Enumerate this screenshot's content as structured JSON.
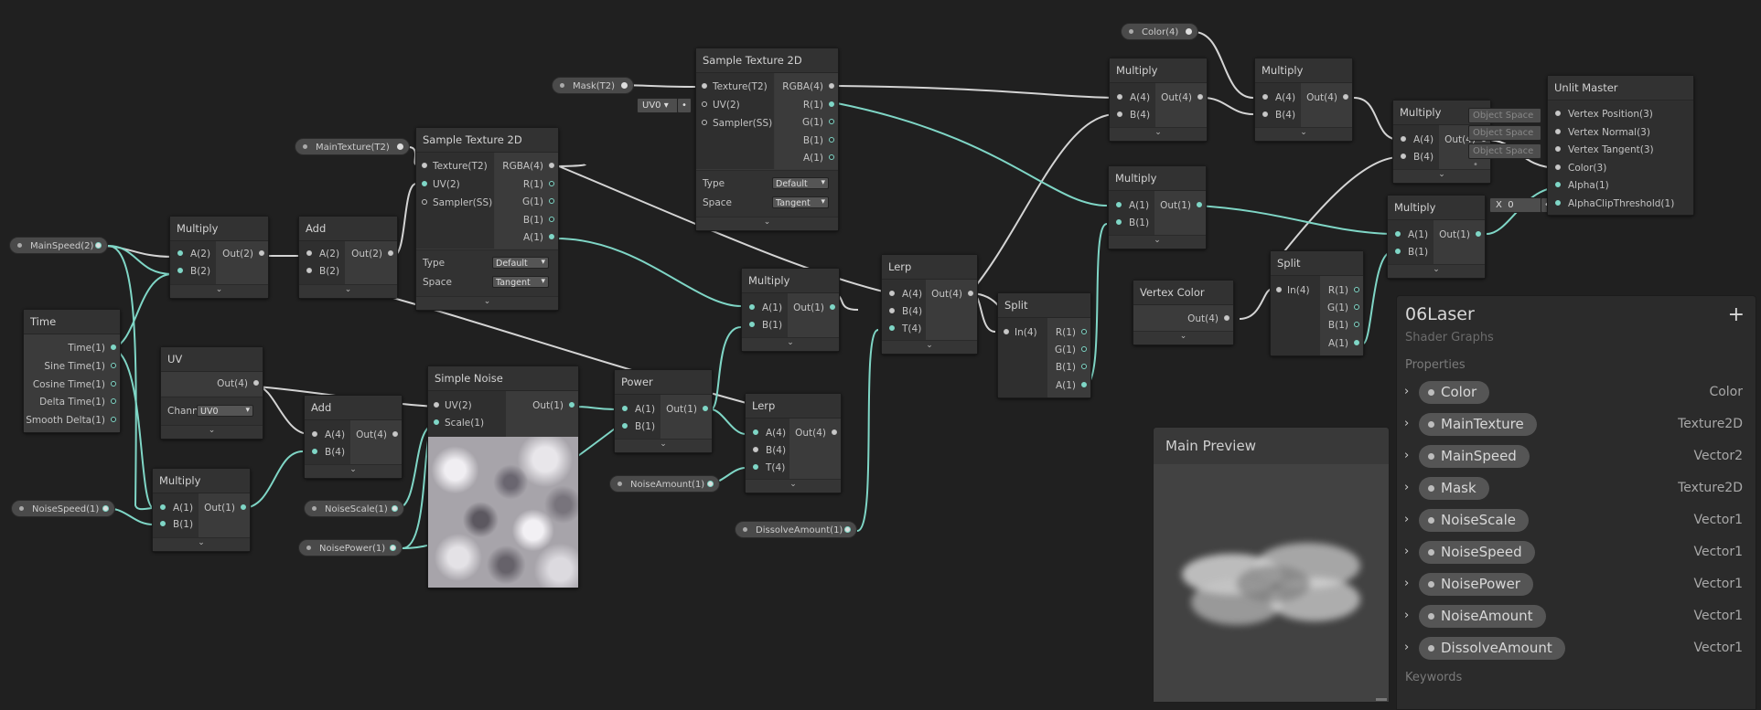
{
  "graph": {
    "nodes": {
      "time": {
        "title": "Time",
        "outputs": [
          "Time(1)",
          "Sine Time(1)",
          "Cosine Time(1)",
          "Delta Time(1)",
          "Smooth Delta(1)"
        ]
      },
      "uv": {
        "title": "UV",
        "output": "Out(4)",
        "channel_label": "Channe",
        "channel_value": "UV0"
      },
      "multiply1": {
        "title": "Multiply",
        "inputs": [
          "A(2)",
          "B(2)"
        ],
        "output": "Out(2)"
      },
      "add1": {
        "title": "Add",
        "inputs": [
          "A(2)",
          "B(2)"
        ],
        "output": "Out(2)"
      },
      "multiply2": {
        "title": "Multiply",
        "inputs": [
          "A(1)",
          "B(1)"
        ],
        "output": "Out(1)"
      },
      "add2": {
        "title": "Add",
        "inputs": [
          "A(4)",
          "B(4)"
        ],
        "output": "Out(4)"
      },
      "sample1": {
        "title": "Sample Texture 2D",
        "inputs": [
          "Texture(T2)",
          "UV(2)",
          "Sampler(SS)"
        ],
        "outputs": [
          "RGBA(4)",
          "R(1)",
          "G(1)",
          "B(1)",
          "A(1)"
        ],
        "type_label": "Type",
        "type_value": "Default",
        "space_label": "Space",
        "space_value": "Tangent"
      },
      "noise": {
        "title": "Simple Noise",
        "inputs": [
          "UV(2)",
          "Scale(1)"
        ],
        "output": "Out(1)"
      },
      "sample2": {
        "title": "Sample Texture 2D",
        "inputs": [
          "Texture(T2)",
          "UV(2)",
          "Sampler(SS)"
        ],
        "outputs": [
          "RGBA(4)",
          "R(1)",
          "G(1)",
          "B(1)",
          "A(1)"
        ],
        "type_label": "Type",
        "type_value": "Default",
        "space_label": "Space",
        "space_value": "Tangent",
        "uv_dropdown": "UV0"
      },
      "power": {
        "title": "Power",
        "inputs": [
          "A(1)",
          "B(1)"
        ],
        "output": "Out(1)"
      },
      "multiply3": {
        "title": "Multiply",
        "inputs": [
          "A(1)",
          "B(1)"
        ],
        "output": "Out(1)"
      },
      "lerp1": {
        "title": "Lerp",
        "inputs": [
          "A(4)",
          "B(4)",
          "T(4)"
        ],
        "output": "Out(4)"
      },
      "lerp2": {
        "title": "Lerp",
        "inputs": [
          "A(4)",
          "B(4)",
          "T(4)"
        ],
        "output": "Out(4)"
      },
      "split1": {
        "title": "Split",
        "input": "In(4)",
        "outputs": [
          "R(1)",
          "G(1)",
          "B(1)",
          "A(1)"
        ]
      },
      "multiply4": {
        "title": "Multiply",
        "inputs": [
          "A(4)",
          "B(4)"
        ],
        "output": "Out(4)"
      },
      "multiply5": {
        "title": "Multiply",
        "inputs": [
          "A(4)",
          "B(4)"
        ],
        "output": "Out(4)"
      },
      "multiply6": {
        "title": "Multiply",
        "inputs": [
          "A(1)",
          "B(1)"
        ],
        "output": "Out(1)"
      },
      "vertexcolor": {
        "title": "Vertex Color",
        "output": "Out(4)"
      },
      "split2": {
        "title": "Split",
        "input": "In(4)",
        "outputs": [
          "R(1)",
          "G(1)",
          "B(1)",
          "A(1)"
        ]
      },
      "multiply7": {
        "title": "Multiply",
        "inputs": [
          "A(4)",
          "B(4)"
        ],
        "output": "Out(4)"
      },
      "multiply8": {
        "title": "Multiply",
        "inputs": [
          "A(1)",
          "B(1)"
        ],
        "output": "Out(1)"
      },
      "master": {
        "title": "Unlit Master",
        "inputs": [
          "Vertex Position(3)",
          "Vertex Normal(3)",
          "Vertex Tangent(3)",
          "Color(3)",
          "Alpha(1)",
          "AlphaClipThreshold(1)"
        ],
        "space_tags": [
          "Object Space",
          "Object Space",
          "Object Space"
        ],
        "clip_x_label": "X",
        "clip_value": "0"
      }
    },
    "properties_nodes": {
      "mainspeed": "MainSpeed(2)",
      "noisespeed": "NoiseSpeed(1)",
      "maintexture": "MainTexture(T2)",
      "noisescale": "NoiseScale(1)",
      "noisepower": "NoisePower(1)",
      "mask": "Mask(T2)",
      "noiseamount": "NoiseAmount(1)",
      "dissolveamount": "DissolveAmount(1)",
      "color": "Color(4)"
    }
  },
  "main_preview": {
    "title": "Main Preview"
  },
  "blackboard": {
    "title": "06Laser",
    "subtitle": "Shader Graphs",
    "add_icon": "+",
    "properties_label": "Properties",
    "keywords_label": "Keywords",
    "properties": [
      {
        "name": "Color",
        "type": "Color"
      },
      {
        "name": "MainTexture",
        "type": "Texture2D"
      },
      {
        "name": "MainSpeed",
        "type": "Vector2"
      },
      {
        "name": "Mask",
        "type": "Texture2D"
      },
      {
        "name": "NoiseScale",
        "type": "Vector1"
      },
      {
        "name": "NoiseSpeed",
        "type": "Vector1"
      },
      {
        "name": "NoisePower",
        "type": "Vector1"
      },
      {
        "name": "NoiseAmount",
        "type": "Vector1"
      },
      {
        "name": "DissolveAmount",
        "type": "Vector1"
      }
    ]
  },
  "colors": {
    "background": "#202020",
    "node": "#393939",
    "wire_vector": "#d2d2d2",
    "wire_scalar": "#7fd6c6"
  }
}
